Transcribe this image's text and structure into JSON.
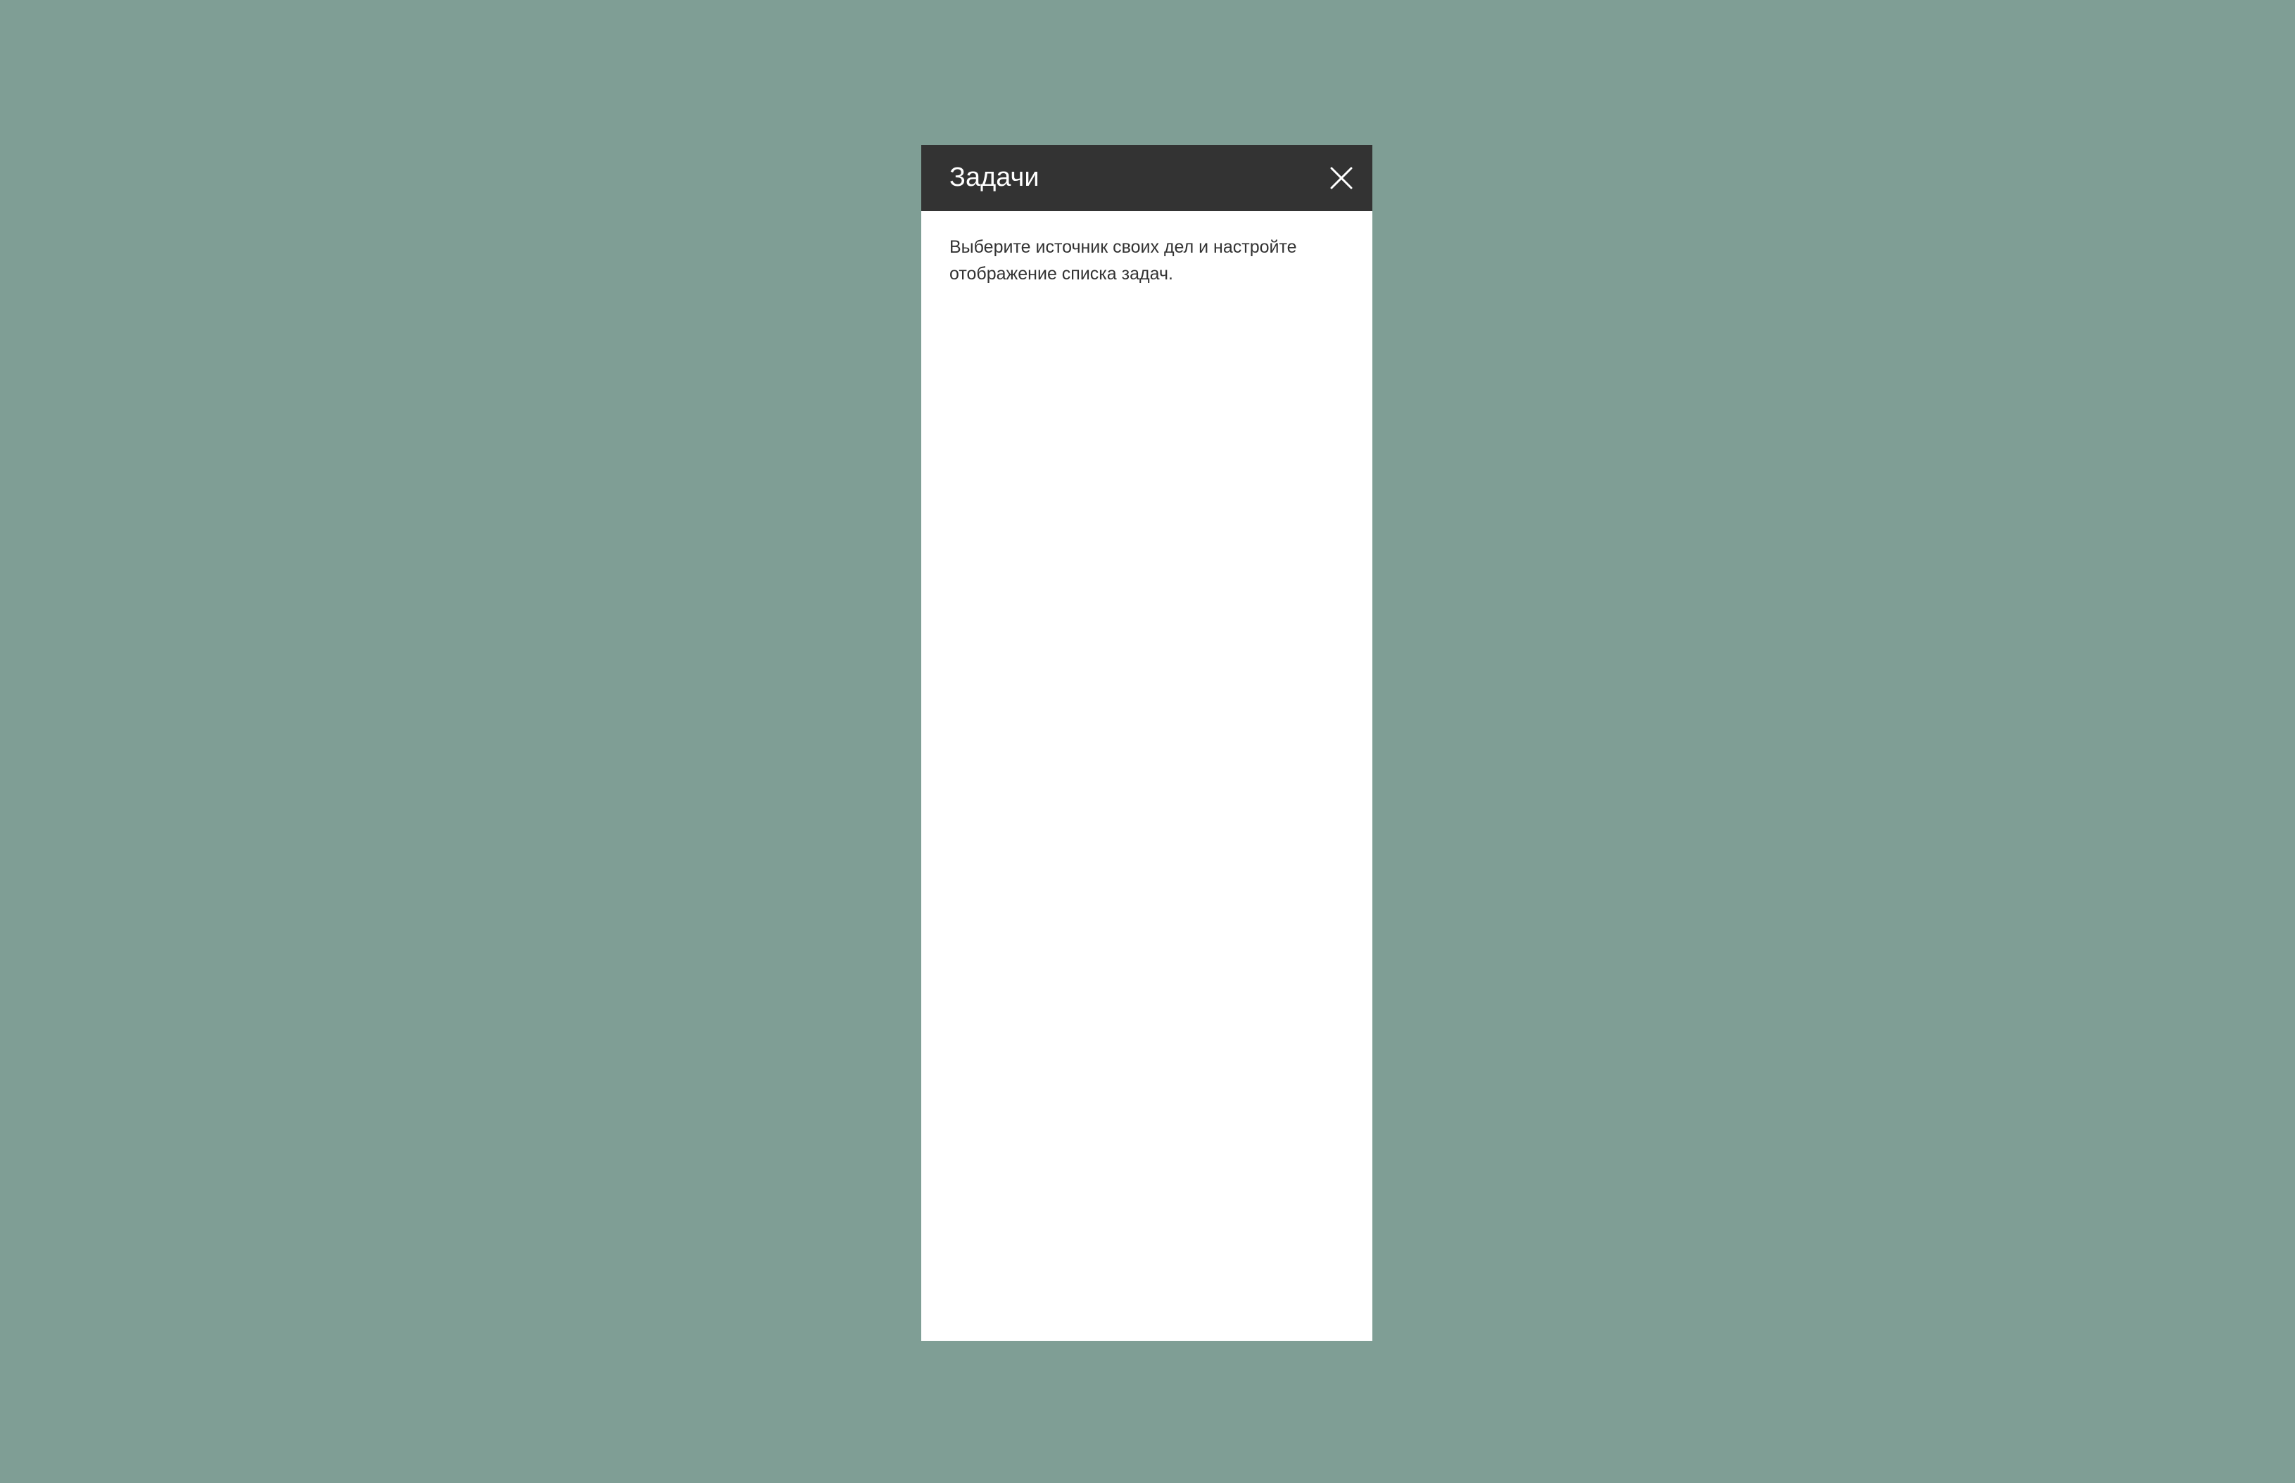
{
  "page": {
    "background_color": "#7f9e95"
  },
  "panel": {
    "title": "Задачи",
    "close_icon": "close-icon",
    "description": "Выберите источник своих дел и настройте отображение списка задач.",
    "header_color": "#333333",
    "body_color": "#ffffff"
  }
}
